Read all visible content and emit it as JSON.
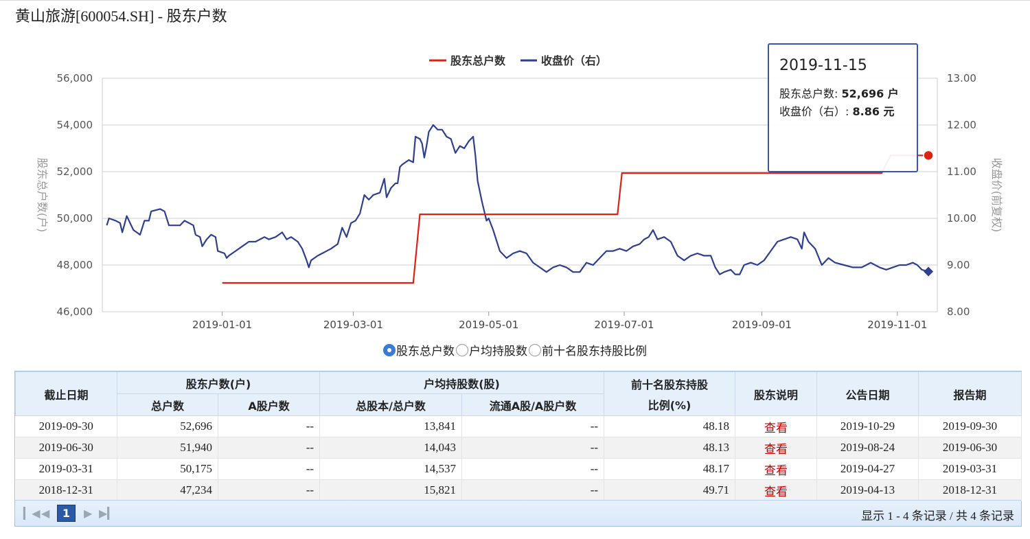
{
  "title": "黄山旅游[600054.SH] - 股东户数",
  "chart_data": {
    "type": "line",
    "legend": [
      "股东总户数",
      "收盘价（右）"
    ],
    "legend_position": "top-center",
    "colors": {
      "holders": "#dd2211",
      "price": "#2e3f8f"
    },
    "y_left_label": "股东总户数(户)",
    "y_right_label": "收盘价(前复权)",
    "y_left_range": [
      46000,
      56000
    ],
    "y_right_range": [
      8.0,
      13.0
    ],
    "y_left_ticks": [
      "46,000",
      "48,000",
      "50,000",
      "52,000",
      "54,000",
      "56,000"
    ],
    "y_right_ticks": [
      "8.00",
      "9.00",
      "10.00",
      "11.00",
      "12.00",
      "13.00"
    ],
    "x_range": [
      "2018-11-08",
      "2019-11-19"
    ],
    "x_ticks": [
      "2019-01-01",
      "2019-03-01",
      "2019-05-01",
      "2019-07-01",
      "2019-09-01",
      "2019-11-01"
    ],
    "grid": "horizontal",
    "holders": [
      {
        "date": "2019-01-01",
        "value": 47234
      },
      {
        "date": "2019-03-28",
        "value": 47234
      },
      {
        "date": "2019-03-31",
        "value": 50175
      },
      {
        "date": "2019-06-28",
        "value": 50175
      },
      {
        "date": "2019-06-30",
        "value": 51940
      },
      {
        "date": "2019-10-25",
        "value": 51940
      },
      {
        "date": "2019-10-29",
        "value": 52696
      },
      {
        "date": "2019-11-15",
        "value": 52696
      }
    ],
    "price": [
      {
        "date": "2018-11-10",
        "value": 9.85
      },
      {
        "date": "2018-11-11",
        "value": 10.0
      },
      {
        "date": "2018-11-14",
        "value": 9.95
      },
      {
        "date": "2018-11-16",
        "value": 9.9
      },
      {
        "date": "2018-11-17",
        "value": 9.7
      },
      {
        "date": "2018-11-19",
        "value": 10.05
      },
      {
        "date": "2018-11-22",
        "value": 9.75
      },
      {
        "date": "2018-11-25",
        "value": 9.65
      },
      {
        "date": "2018-11-27",
        "value": 9.95
      },
      {
        "date": "2018-11-29",
        "value": 9.95
      },
      {
        "date": "2018-11-30",
        "value": 10.15
      },
      {
        "date": "2018-12-04",
        "value": 10.2
      },
      {
        "date": "2018-12-06",
        "value": 10.15
      },
      {
        "date": "2018-12-08",
        "value": 9.85
      },
      {
        "date": "2018-12-10",
        "value": 9.85
      },
      {
        "date": "2018-12-13",
        "value": 9.85
      },
      {
        "date": "2018-12-15",
        "value": 9.95
      },
      {
        "date": "2018-12-19",
        "value": 9.85
      },
      {
        "date": "2018-12-20",
        "value": 9.65
      },
      {
        "date": "2018-12-22",
        "value": 9.6
      },
      {
        "date": "2018-12-23",
        "value": 9.4
      },
      {
        "date": "2018-12-25",
        "value": 9.55
      },
      {
        "date": "2018-12-27",
        "value": 9.65
      },
      {
        "date": "2018-12-29",
        "value": 9.6
      },
      {
        "date": "2018-12-30",
        "value": 9.3
      },
      {
        "date": "2019-01-02",
        "value": 9.25
      },
      {
        "date": "2019-01-03",
        "value": 9.15
      },
      {
        "date": "2019-01-04",
        "value": 9.2
      },
      {
        "date": "2019-01-07",
        "value": 9.3
      },
      {
        "date": "2019-01-10",
        "value": 9.4
      },
      {
        "date": "2019-01-13",
        "value": 9.5
      },
      {
        "date": "2019-01-16",
        "value": 9.5
      },
      {
        "date": "2019-01-18",
        "value": 9.55
      },
      {
        "date": "2019-01-20",
        "value": 9.6
      },
      {
        "date": "2019-01-22",
        "value": 9.55
      },
      {
        "date": "2019-01-25",
        "value": 9.6
      },
      {
        "date": "2019-01-28",
        "value": 9.7
      },
      {
        "date": "2019-01-30",
        "value": 9.55
      },
      {
        "date": "2019-02-01",
        "value": 9.6
      },
      {
        "date": "2019-02-04",
        "value": 9.5
      },
      {
        "date": "2019-02-06",
        "value": 9.35
      },
      {
        "date": "2019-02-08",
        "value": 9.1
      },
      {
        "date": "2019-02-09",
        "value": 8.95
      },
      {
        "date": "2019-02-10",
        "value": 9.1
      },
      {
        "date": "2019-02-13",
        "value": 9.2
      },
      {
        "date": "2019-02-15",
        "value": 9.25
      },
      {
        "date": "2019-02-19",
        "value": 9.35
      },
      {
        "date": "2019-02-22",
        "value": 9.45
      },
      {
        "date": "2019-02-24",
        "value": 9.8
      },
      {
        "date": "2019-02-26",
        "value": 9.6
      },
      {
        "date": "2019-02-28",
        "value": 9.9
      },
      {
        "date": "2019-03-02",
        "value": 9.95
      },
      {
        "date": "2019-03-04",
        "value": 10.1
      },
      {
        "date": "2019-03-06",
        "value": 10.5
      },
      {
        "date": "2019-03-08",
        "value": 10.4
      },
      {
        "date": "2019-03-10",
        "value": 10.5
      },
      {
        "date": "2019-03-13",
        "value": 10.55
      },
      {
        "date": "2019-03-15",
        "value": 10.85
      },
      {
        "date": "2019-03-16",
        "value": 10.45
      },
      {
        "date": "2019-03-18",
        "value": 10.65
      },
      {
        "date": "2019-03-20",
        "value": 10.75
      },
      {
        "date": "2019-03-21",
        "value": 10.75
      },
      {
        "date": "2019-03-22",
        "value": 11.1
      },
      {
        "date": "2019-03-23",
        "value": 11.15
      },
      {
        "date": "2019-03-26",
        "value": 11.25
      },
      {
        "date": "2019-03-28",
        "value": 11.2
      },
      {
        "date": "2019-03-29",
        "value": 11.75
      },
      {
        "date": "2019-03-31",
        "value": 11.7
      },
      {
        "date": "2019-04-01",
        "value": 11.6
      },
      {
        "date": "2019-04-02",
        "value": 11.3
      },
      {
        "date": "2019-04-03",
        "value": 11.55
      },
      {
        "date": "2019-04-04",
        "value": 11.85
      },
      {
        "date": "2019-04-06",
        "value": 12.0
      },
      {
        "date": "2019-04-08",
        "value": 11.9
      },
      {
        "date": "2019-04-10",
        "value": 11.9
      },
      {
        "date": "2019-04-12",
        "value": 11.75
      },
      {
        "date": "2019-04-14",
        "value": 11.7
      },
      {
        "date": "2019-04-16",
        "value": 11.4
      },
      {
        "date": "2019-04-18",
        "value": 11.55
      },
      {
        "date": "2019-04-20",
        "value": 11.5
      },
      {
        "date": "2019-04-22",
        "value": 11.65
      },
      {
        "date": "2019-04-24",
        "value": 11.75
      },
      {
        "date": "2019-04-25",
        "value": 11.35
      },
      {
        "date": "2019-04-26",
        "value": 10.8
      },
      {
        "date": "2019-04-28",
        "value": 10.35
      },
      {
        "date": "2019-04-30",
        "value": 9.95
      },
      {
        "date": "2019-05-01",
        "value": 10.0
      },
      {
        "date": "2019-05-03",
        "value": 9.75
      },
      {
        "date": "2019-05-06",
        "value": 9.3
      },
      {
        "date": "2019-05-09",
        "value": 9.15
      },
      {
        "date": "2019-05-12",
        "value": 9.25
      },
      {
        "date": "2019-05-15",
        "value": 9.3
      },
      {
        "date": "2019-05-18",
        "value": 9.25
      },
      {
        "date": "2019-05-21",
        "value": 9.05
      },
      {
        "date": "2019-05-24",
        "value": 8.95
      },
      {
        "date": "2019-05-27",
        "value": 8.85
      },
      {
        "date": "2019-05-30",
        "value": 8.95
      },
      {
        "date": "2019-06-02",
        "value": 9.0
      },
      {
        "date": "2019-06-05",
        "value": 8.95
      },
      {
        "date": "2019-06-08",
        "value": 8.85
      },
      {
        "date": "2019-06-11",
        "value": 8.85
      },
      {
        "date": "2019-06-14",
        "value": 9.05
      },
      {
        "date": "2019-06-17",
        "value": 9.0
      },
      {
        "date": "2019-06-20",
        "value": 9.15
      },
      {
        "date": "2019-06-23",
        "value": 9.3
      },
      {
        "date": "2019-06-26",
        "value": 9.3
      },
      {
        "date": "2019-06-29",
        "value": 9.35
      },
      {
        "date": "2019-07-02",
        "value": 9.3
      },
      {
        "date": "2019-07-05",
        "value": 9.4
      },
      {
        "date": "2019-07-08",
        "value": 9.45
      },
      {
        "date": "2019-07-10",
        "value": 9.55
      },
      {
        "date": "2019-07-12",
        "value": 9.6
      },
      {
        "date": "2019-07-14",
        "value": 9.75
      },
      {
        "date": "2019-07-16",
        "value": 9.55
      },
      {
        "date": "2019-07-19",
        "value": 9.6
      },
      {
        "date": "2019-07-22",
        "value": 9.5
      },
      {
        "date": "2019-07-25",
        "value": 9.2
      },
      {
        "date": "2019-07-28",
        "value": 9.1
      },
      {
        "date": "2019-07-31",
        "value": 9.2
      },
      {
        "date": "2019-08-03",
        "value": 9.25
      },
      {
        "date": "2019-08-06",
        "value": 9.2
      },
      {
        "date": "2019-08-09",
        "value": 9.2
      },
      {
        "date": "2019-08-11",
        "value": 8.95
      },
      {
        "date": "2019-08-13",
        "value": 8.8
      },
      {
        "date": "2019-08-15",
        "value": 8.85
      },
      {
        "date": "2019-08-18",
        "value": 8.9
      },
      {
        "date": "2019-08-20",
        "value": 8.8
      },
      {
        "date": "2019-08-22",
        "value": 8.8
      },
      {
        "date": "2019-08-24",
        "value": 9.0
      },
      {
        "date": "2019-08-27",
        "value": 9.05
      },
      {
        "date": "2019-08-30",
        "value": 9.0
      },
      {
        "date": "2019-09-02",
        "value": 9.1
      },
      {
        "date": "2019-09-05",
        "value": 9.3
      },
      {
        "date": "2019-09-08",
        "value": 9.5
      },
      {
        "date": "2019-09-11",
        "value": 9.55
      },
      {
        "date": "2019-09-14",
        "value": 9.6
      },
      {
        "date": "2019-09-17",
        "value": 9.55
      },
      {
        "date": "2019-09-19",
        "value": 9.35
      },
      {
        "date": "2019-09-20",
        "value": 9.7
      },
      {
        "date": "2019-09-22",
        "value": 9.5
      },
      {
        "date": "2019-09-25",
        "value": 9.35
      },
      {
        "date": "2019-09-28",
        "value": 9.0
      },
      {
        "date": "2019-10-01",
        "value": 9.15
      },
      {
        "date": "2019-10-04",
        "value": 9.05
      },
      {
        "date": "2019-10-08",
        "value": 9.0
      },
      {
        "date": "2019-10-12",
        "value": 8.95
      },
      {
        "date": "2019-10-16",
        "value": 8.95
      },
      {
        "date": "2019-10-20",
        "value": 9.05
      },
      {
        "date": "2019-10-24",
        "value": 8.95
      },
      {
        "date": "2019-10-27",
        "value": 8.9
      },
      {
        "date": "2019-10-30",
        "value": 8.95
      },
      {
        "date": "2019-11-02",
        "value": 9.0
      },
      {
        "date": "2019-11-05",
        "value": 9.0
      },
      {
        "date": "2019-11-08",
        "value": 9.05
      },
      {
        "date": "2019-11-10",
        "value": 9.0
      },
      {
        "date": "2019-11-12",
        "value": 8.9
      },
      {
        "date": "2019-11-15",
        "value": 8.86
      }
    ],
    "tooltip": {
      "date": "2019-11-15",
      "holders_label": "股东总户数: ",
      "holders_value": "52,696 户",
      "price_label": "收盘价（右）: ",
      "price_value": "8.86 元"
    }
  },
  "radio": {
    "options": [
      "股东总户数",
      "户均持股数",
      "前十名股东持股比例"
    ],
    "selected": 0
  },
  "table": {
    "header": {
      "date": "截止日期",
      "holders_group": "股东户数(户)",
      "total": "总户数",
      "a_count": "A股户数",
      "avg_group": "户均持股数(股)",
      "avg_total": "总股本/总户数",
      "avg_a": "流通A股/A股户数",
      "top10_line1": "前十名股东持股",
      "top10_line2": "比例(%)",
      "note": "股东说明",
      "announce": "公告日期",
      "report": "报告期"
    },
    "rows": [
      {
        "date": "2019-09-30",
        "total": "52,696",
        "a_count": "--",
        "avg_total": "13,841",
        "avg_a": "--",
        "top10": "48.18",
        "note": "查看",
        "announce": "2019-10-29",
        "report": "2019-09-30"
      },
      {
        "date": "2019-06-30",
        "total": "51,940",
        "a_count": "--",
        "avg_total": "14,043",
        "avg_a": "--",
        "top10": "48.13",
        "note": "查看",
        "announce": "2019-08-24",
        "report": "2019-06-30"
      },
      {
        "date": "2019-03-31",
        "total": "50,175",
        "a_count": "--",
        "avg_total": "14,537",
        "avg_a": "--",
        "top10": "48.17",
        "note": "查看",
        "announce": "2019-04-27",
        "report": "2019-03-31"
      },
      {
        "date": "2018-12-31",
        "total": "47,234",
        "a_count": "--",
        "avg_total": "15,821",
        "avg_a": "--",
        "top10": "49.71",
        "note": "查看",
        "announce": "2019-04-13",
        "report": "2018-12-31"
      }
    ]
  },
  "pager": {
    "current": "1",
    "info": "显示 1 - 4 条记录 / 共 4 条记录"
  }
}
